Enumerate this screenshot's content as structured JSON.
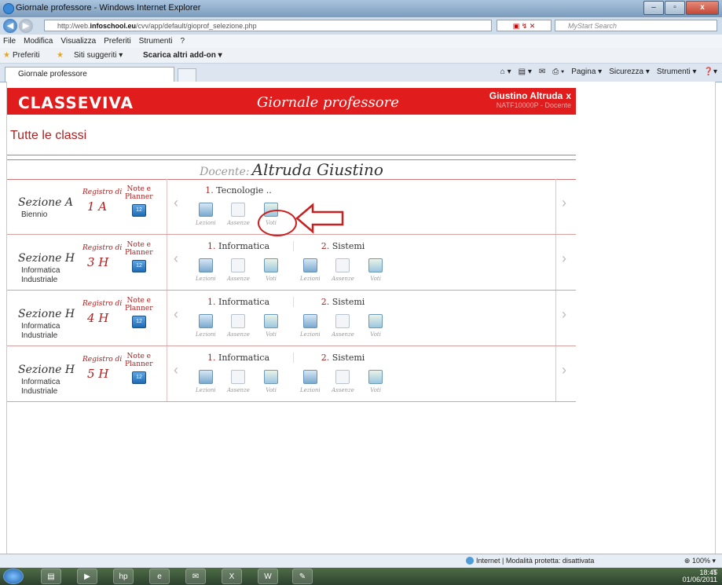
{
  "window": {
    "title": "Giornale professore - Windows Internet Explorer",
    "buttons": [
      "–",
      "▫",
      "x"
    ]
  },
  "address": {
    "url_prefix": "http://web.",
    "url_domain": "infoschool.eu",
    "url_rest": "/cvv/app/default/gioprof_selezione.php",
    "search_placeholder": "MyStart Search"
  },
  "menu": [
    "File",
    "Modifica",
    "Visualizza",
    "Preferiti",
    "Strumenti",
    "?"
  ],
  "favorites": {
    "label": "Preferiti",
    "suggested": "Siti suggeriti ▾",
    "addons": "Scarica altri add-on ▾"
  },
  "tab": {
    "label": "Giornale professore"
  },
  "command_bar": [
    "Pagina ▾",
    "Sicurezza ▾",
    "Strumenti ▾"
  ],
  "header": {
    "logo": "CLASSEVIVA",
    "title": "Giornale professore",
    "user_name": "Giustino Altruda",
    "close": "x",
    "user_sub": "NATF10000P - Docente"
  },
  "page": {
    "heading": "Tutte le classi",
    "docente_label": "Docente:",
    "docente_name": "Altruda Giustino"
  },
  "labels": {
    "registro": "Registro di",
    "note": "Note e",
    "planner": "Planner",
    "lezioni": "Lezioni",
    "assenze": "Assenze",
    "voti": "Voti"
  },
  "classes": [
    {
      "section": "Sezione A",
      "sub1": "Biennio",
      "sub2": "",
      "class": "1 A",
      "subjects": [
        {
          "num": "1.",
          "name": "Tecnologie .."
        }
      ]
    },
    {
      "section": "Sezione H",
      "sub1": "Informatica",
      "sub2": "Industriale",
      "class": "3 H",
      "subjects": [
        {
          "num": "1.",
          "name": "Informatica"
        },
        {
          "num": "2.",
          "name": "Sistemi"
        }
      ]
    },
    {
      "section": "Sezione H",
      "sub1": "Informatica",
      "sub2": "Industriale",
      "class": "4 H",
      "subjects": [
        {
          "num": "1.",
          "name": "Informatica"
        },
        {
          "num": "2.",
          "name": "Sistemi"
        }
      ]
    },
    {
      "section": "Sezione H",
      "sub1": "Informatica",
      "sub2": "Industriale",
      "class": "5 H",
      "subjects": [
        {
          "num": "1.",
          "name": "Informatica"
        },
        {
          "num": "2.",
          "name": "Sistemi"
        }
      ]
    }
  ],
  "status": {
    "zone": "Internet | Modalità protetta: disattivata",
    "zoom": "100%"
  },
  "taskbar": {
    "lang": "IT",
    "time": "18:45",
    "date": "01/06/2011"
  },
  "colors": {
    "brand_red": "#e01c1c",
    "accent_red": "#b01e1e"
  }
}
